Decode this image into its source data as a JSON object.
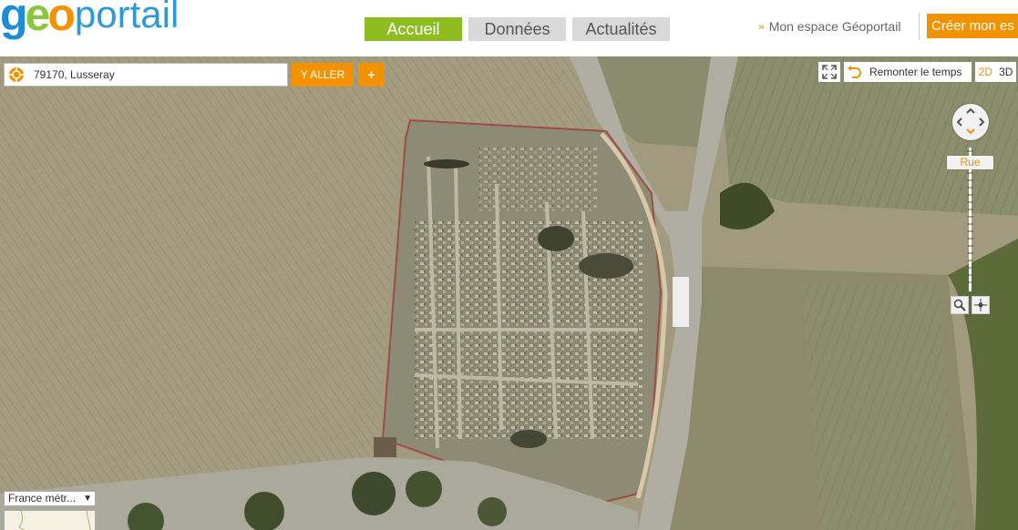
{
  "header": {
    "logo": {
      "part1_g": "g",
      "part1_e": "e",
      "part1_o": "o",
      "part2": "portail"
    },
    "nav": [
      {
        "label": "Accueil",
        "active": true
      },
      {
        "label": "Données",
        "active": false
      },
      {
        "label": "Actualités",
        "active": false
      }
    ],
    "account_link": {
      "chevron": "»",
      "label": "Mon espace Géoportail"
    },
    "create_button": "Créer mon es"
  },
  "map": {
    "search": {
      "value": "79170, Lusseray",
      "placeholder": ""
    },
    "go_button": "Y ALLER",
    "plus_button": "+",
    "fullscreen_icon": "fullscreen-icon",
    "time_button": "Remonter le temps",
    "view_2d": "2D",
    "view_3d": "3D",
    "zoom_label": "Rue",
    "crs_select": "France métr...",
    "colors": {
      "accent": "#f39200",
      "nav_active": "#8dbd1f",
      "nav_inactive": "#d9d9d9"
    }
  }
}
